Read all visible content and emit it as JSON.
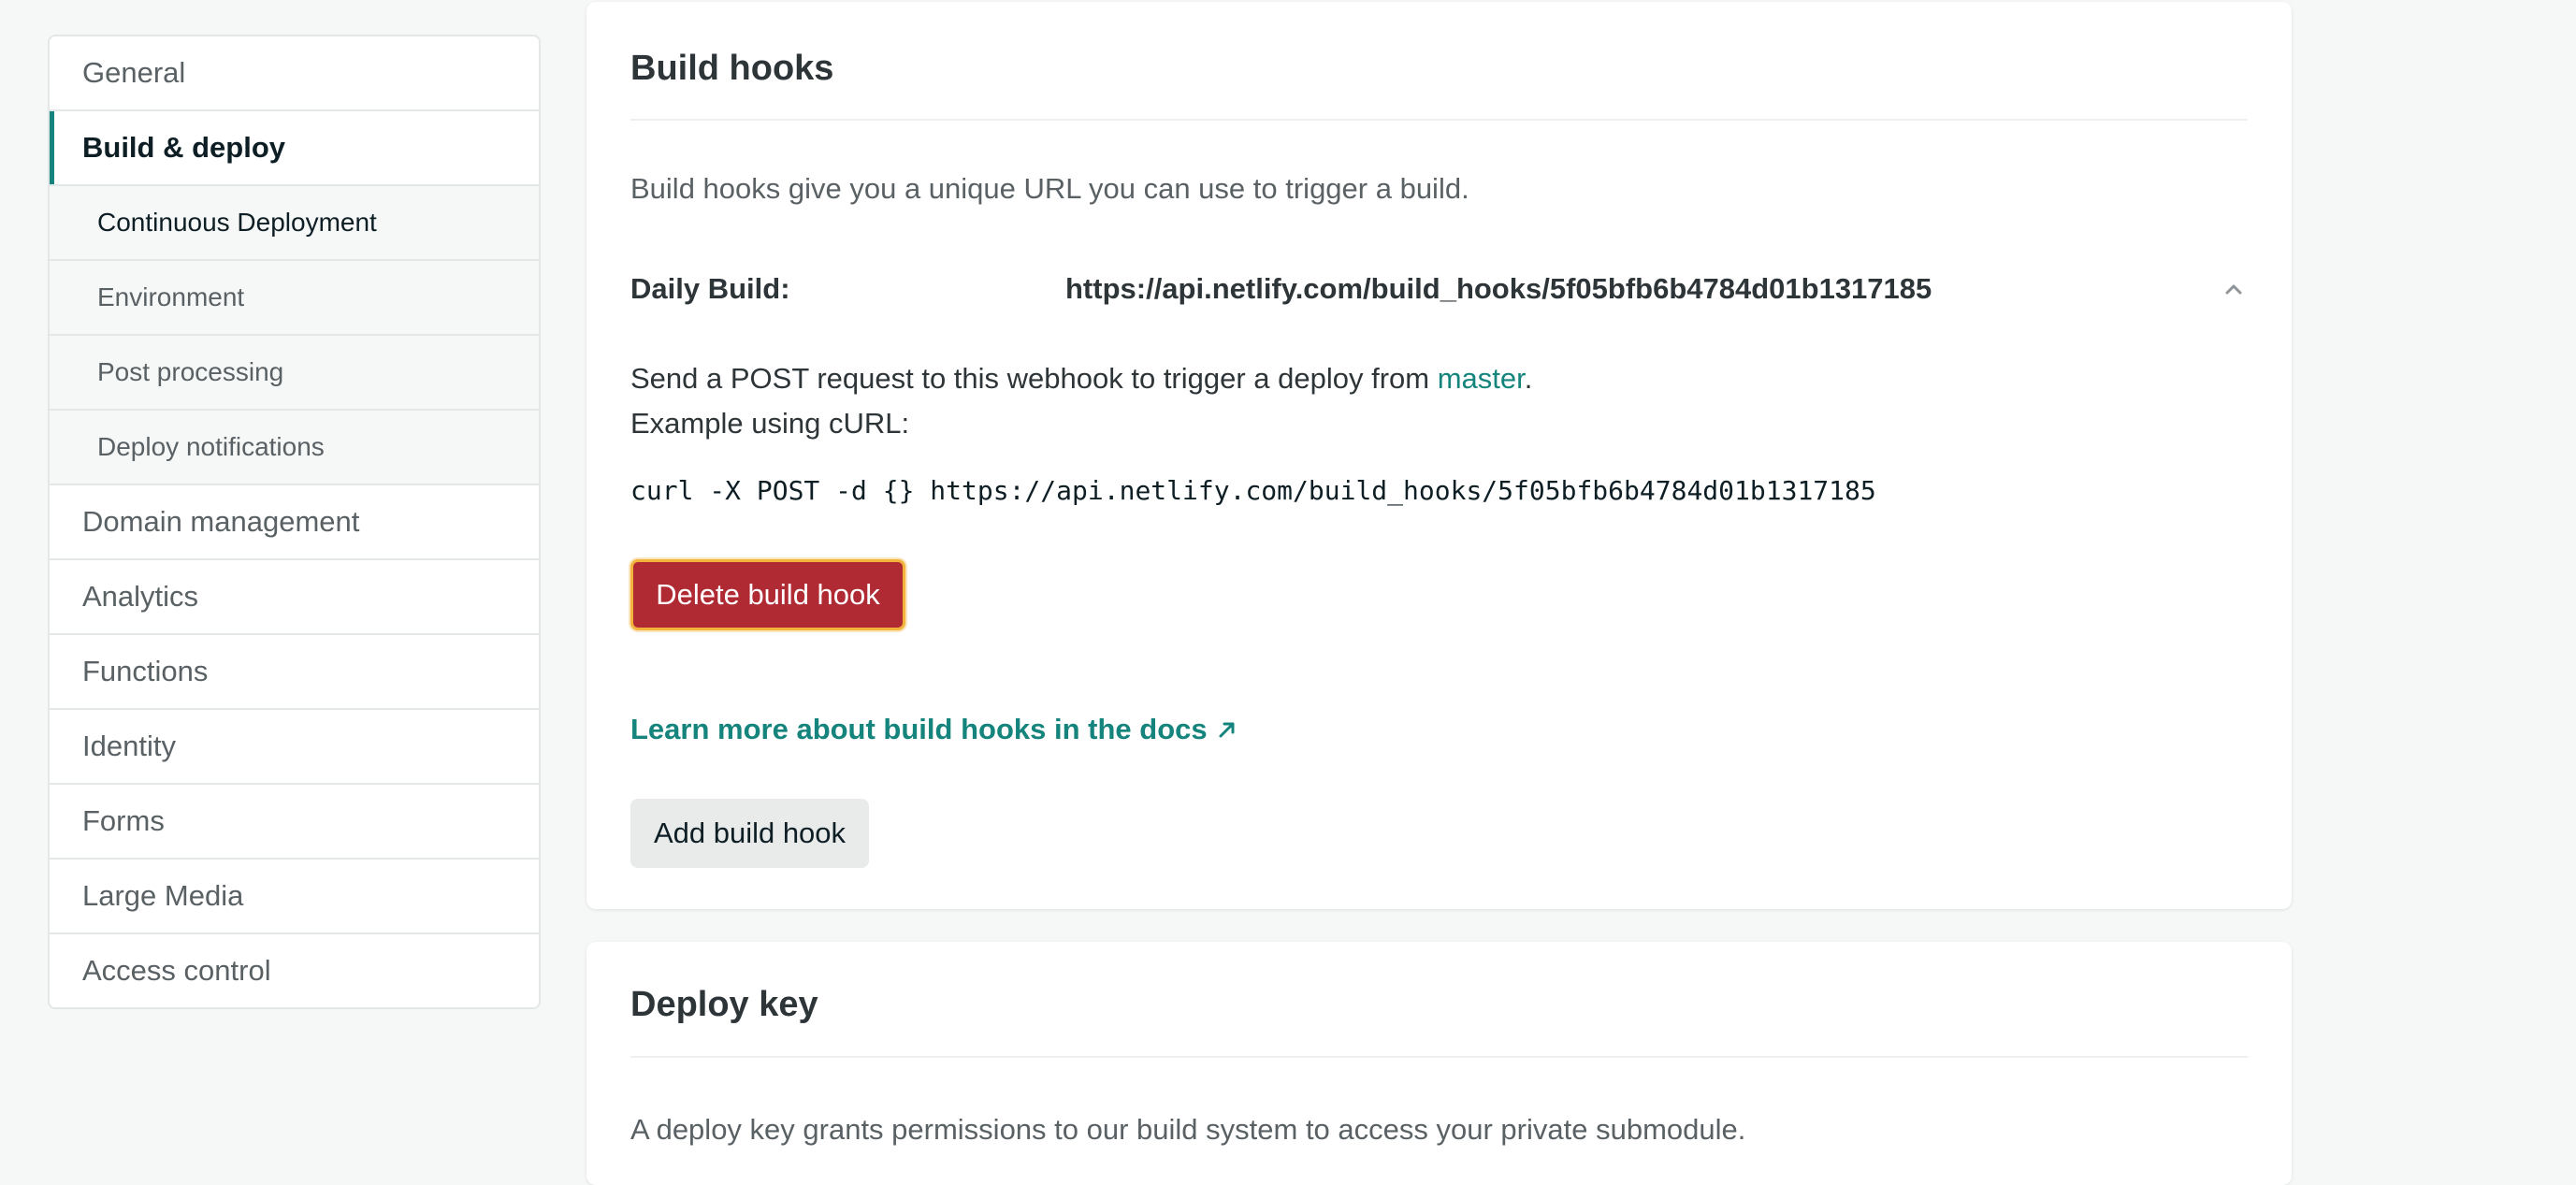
{
  "sidebar": {
    "items": [
      {
        "label": "General"
      },
      {
        "label": "Build & deploy"
      },
      {
        "label": "Continuous Deployment"
      },
      {
        "label": "Environment"
      },
      {
        "label": "Post processing"
      },
      {
        "label": "Deploy notifications"
      },
      {
        "label": "Domain management"
      },
      {
        "label": "Analytics"
      },
      {
        "label": "Functions"
      },
      {
        "label": "Identity"
      },
      {
        "label": "Forms"
      },
      {
        "label": "Large Media"
      },
      {
        "label": "Access control"
      }
    ]
  },
  "build_hooks": {
    "title": "Build hooks",
    "intro": "Build hooks give you a unique URL you can use to trigger a build.",
    "hook_name": "Daily Build:",
    "hook_url": "https://api.netlify.com/build_hooks/5f05bfb6b4784d01b1317185",
    "desc_prefix": "Send a POST request to this webhook to trigger a deploy from ",
    "branch": "master",
    "desc_suffix": ".",
    "example_label": "Example using cURL:",
    "curl_command": "curl -X POST -d {} https://api.netlify.com/build_hooks/5f05bfb6b4784d01b1317185",
    "delete_label": "Delete build hook",
    "docs_link": "Learn more about build hooks in the docs",
    "add_label": "Add build hook"
  },
  "deploy_key": {
    "title": "Deploy key",
    "desc": "A deploy key grants permissions to our build system to access your private submodule."
  },
  "colors": {
    "accent": "#15847d",
    "danger": "#b02a33",
    "focus_ring": "#f2b33d"
  }
}
